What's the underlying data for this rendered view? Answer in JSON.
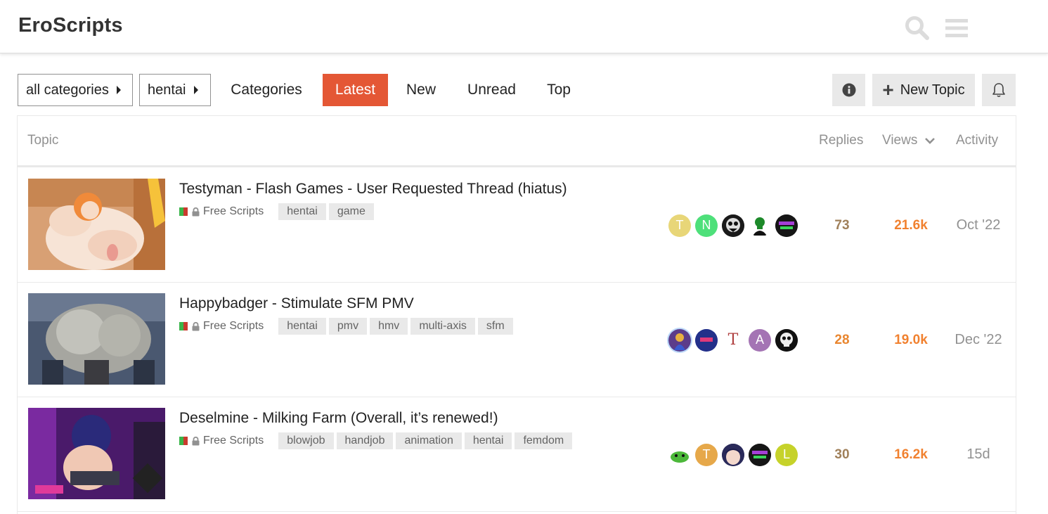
{
  "header": {
    "site_title": "EroScripts",
    "search_icon": "search-icon",
    "menu_icon": "hamburger-menu-icon"
  },
  "nav": {
    "category_dropdown": "all categories",
    "tag_dropdown": "hentai",
    "links": [
      "Categories",
      "Latest",
      "New",
      "Unread",
      "Top"
    ],
    "active": "Latest",
    "new_topic_label": "New Topic",
    "info_icon": "info-icon",
    "bell_icon": "bell-icon"
  },
  "list": {
    "headers": {
      "topic": "Topic",
      "replies": "Replies",
      "views": "Views",
      "activity": "Activity"
    },
    "topics": [
      {
        "title": "Testyman - Flash Games - User Requested Thread (hiatus)",
        "category": "Free Scripts",
        "tags": [
          "hentai",
          "game"
        ],
        "posters": [
          "T",
          "N",
          "",
          "",
          ""
        ],
        "replies": "73",
        "views": "21.6k",
        "activity": "Oct '22"
      },
      {
        "title": "Happybadger - Stimulate SFM PMV",
        "category": "Free Scripts",
        "tags": [
          "hentai",
          "pmv",
          "hmv",
          "multi-axis",
          "sfm"
        ],
        "posters": [
          "",
          "",
          "T",
          "A",
          ""
        ],
        "replies": "28",
        "views": "19.0k",
        "activity": "Dec '22"
      },
      {
        "title": "Deselmine - Milking Farm (Overall, it’s renewed!)",
        "category": "Free Scripts",
        "tags": [
          "blowjob",
          "handjob",
          "animation",
          "hentai",
          "femdom"
        ],
        "posters": [
          "",
          "T",
          "",
          "",
          "L"
        ],
        "replies": "30",
        "views": "16.2k",
        "activity": "15d"
      }
    ]
  },
  "colors": {
    "accent": "#e45735",
    "views_hot": "#f1812f",
    "replies_warm": "#a0805a",
    "replies_hot": "#e9862f",
    "avatar_t_yellow": "#e8d678",
    "avatar_n_green": "#4ee07a",
    "avatar_a_purple": "#a474b4",
    "avatar_t_orange": "#e6a84a",
    "avatar_l_lime": "#c6d22a"
  }
}
